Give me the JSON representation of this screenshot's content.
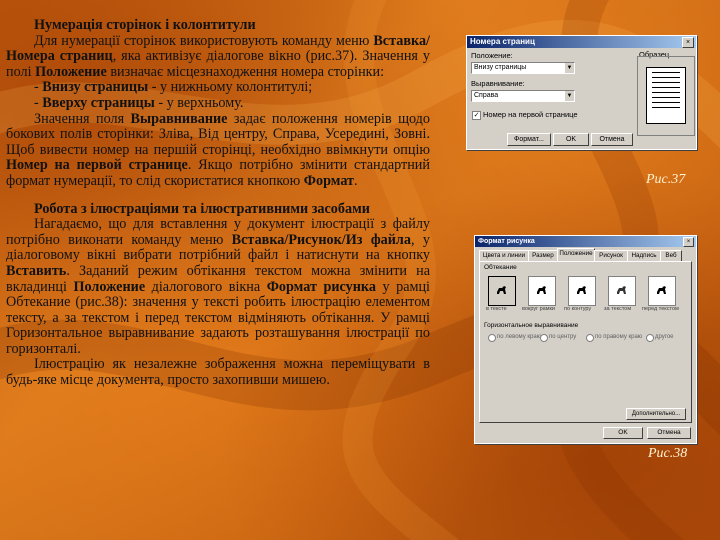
{
  "section1": {
    "heading": "Нумерація сторінок і колонтитули",
    "p1_a": "Для нумерації сторінок використовують команду меню ",
    "p1_cmd": "Вставка/Номера страниц",
    "p1_b": ", яка активізує діалогове вікно (рис.37). Значення у полі ",
    "p1_field": "Положение",
    "p1_c": " визначає місцезнаходження номера сторінки:",
    "item1_dash": "- ",
    "item1_bold": "Внизу страницы",
    "item1_rest": " - у нижньому колонтитулі;",
    "item2_dash": "- ",
    "item2_bold": "Вверху страницы",
    "item2_rest": " - у верхньому.",
    "p2_a": "Значення поля ",
    "p2_field": "Выравнивание",
    "p2_b": " задає положення номерів щодо бокових полів сторінки: Зліва, Від центру, Справа, Усередині, Зовні. Щоб вивести номер на першій сторінці, необхідно ввімкнути опцію ",
    "p2_opt": "Номер на первой странице",
    "p2_c": ". Якщо потрібно змінити стандартний формат нумерації, то слід скористатися кнопкою ",
    "p2_btn": "Формат",
    "p2_d": "."
  },
  "section2": {
    "heading": "Робота з ілюстраціями та ілюстративними засобами",
    "p1_a": "Нагадаємо, що для вставлення у документ ілюстрації з файлу потрібно виконати команду меню ",
    "p1_cmd": "Вставка/Рисунок/Из файла",
    "p1_b": ", у діалоговому вікні вибрати потрібний файл і натиснути на кнопку ",
    "p1_btn": "Вставить",
    "p1_c": ". Заданий режим обтікання текстом можна змінити на вкладинці ",
    "p1_tab": "Положение",
    "p1_d": " діалогового вікна ",
    "p1_dlg": "Формат рисунка",
    "p1_e": " у рамці Обтекание (рис.38): значення у тексті робить ілюстрацію елементом тексту, а за текстом і перед текстом відміняють обтікання. У рамці Горизонтальное выравнивание задають розташування ілюстрації по горизонталі.",
    "p2": "Ілюстрацію як незалежне зображення можна переміщувати в будь-яке місце документа, просто захопивши мишею."
  },
  "figure37": {
    "caption": "Рис.37",
    "title": "Номера страниц",
    "close": "×",
    "position_label": "Положение:",
    "position_value": "Внизу страницы",
    "align_label": "Выравнивание:",
    "align_value": "Справа",
    "first_page_label": "Номер на первой странице",
    "first_page_checked": "✓",
    "sample_label": "Образец",
    "ok": "OK",
    "cancel": "Отмена",
    "format": "Формат..."
  },
  "figure38": {
    "caption": "Рис.38",
    "title": "Формат рисунка",
    "close": "×",
    "tabs": [
      "Цвета и линии",
      "Размер",
      "Положение",
      "Рисунок",
      "Надпись",
      "Веб"
    ],
    "wrap_label": "Обтекание",
    "wrap_options": [
      "в тексте",
      "вокруг рамки",
      "по контуру",
      "за текстом",
      "перед текстом"
    ],
    "halign_label": "Горизонтальное выравнивание",
    "halign_options": [
      "по левому краю",
      "по центру",
      "по правому краю",
      "другое"
    ],
    "more": "Дополнительно...",
    "ok": "OK",
    "cancel": "Отмена"
  },
  "colors": {
    "background": "#d06a14",
    "caption": "#fff3d0",
    "title_bar": "#0a246a"
  }
}
